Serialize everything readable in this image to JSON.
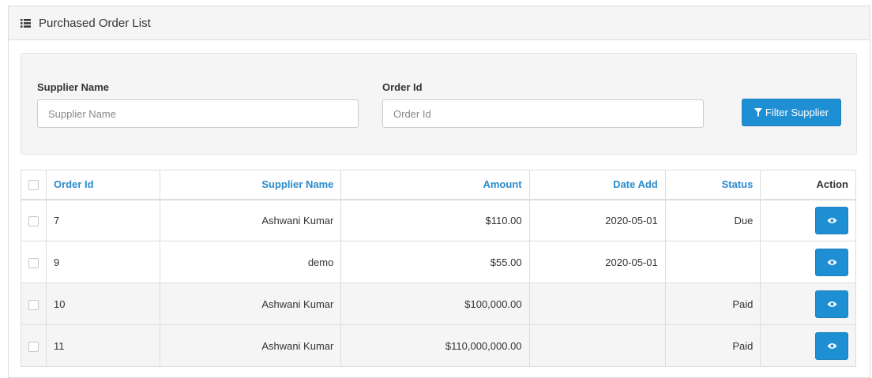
{
  "panel": {
    "title": "Purchased Order List",
    "title_icon": "list-icon"
  },
  "filter": {
    "supplier_label": "Supplier Name",
    "supplier_placeholder": "Supplier Name",
    "supplier_value": "",
    "order_label": "Order Id",
    "order_placeholder": "Order Id",
    "order_value": "",
    "button_label": "Filter Supplier",
    "button_icon": "filter-icon"
  },
  "table": {
    "headers": [
      "Order Id",
      "Supplier Name",
      "Amount",
      "Date Add",
      "Status",
      "Action"
    ],
    "rows": [
      {
        "order_id": "7",
        "supplier": "Ashwani Kumar",
        "amount": "$110.00",
        "date": "2020-05-01",
        "status": "Due"
      },
      {
        "order_id": "9",
        "supplier": "demo",
        "amount": "$55.00",
        "date": "2020-05-01",
        "status": ""
      },
      {
        "order_id": "10",
        "supplier": "Ashwani Kumar",
        "amount": "$100,000.00",
        "date": "",
        "status": "Paid"
      },
      {
        "order_id": "11",
        "supplier": "Ashwani Kumar",
        "amount": "$110,000,000.00",
        "date": "",
        "status": "Paid"
      }
    ],
    "action_icon": "eye-icon"
  },
  "colors": {
    "primary": "#1f8fd4",
    "header_link": "#2a8bcc",
    "panel_heading_bg": "#f5f5f5",
    "stripe": "#f5f5f5"
  }
}
